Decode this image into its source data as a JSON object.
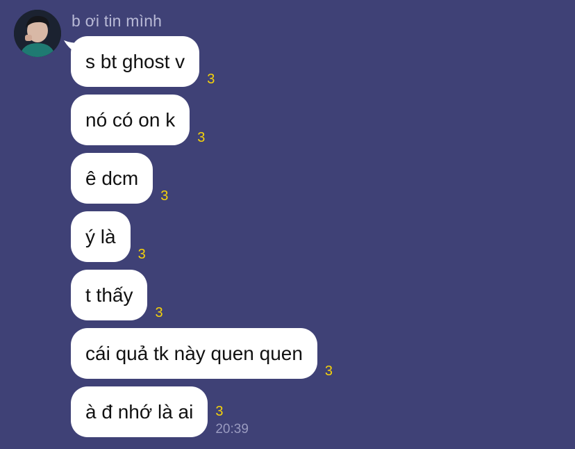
{
  "sender": {
    "name": "b ơi tin mình"
  },
  "messages": [
    {
      "text": "s bt ghost v",
      "read_count": "3"
    },
    {
      "text": "nó có on k",
      "read_count": "3"
    },
    {
      "text": "ê dcm",
      "read_count": "3"
    },
    {
      "text": "ý là",
      "read_count": "3"
    },
    {
      "text": "t thấy",
      "read_count": "3"
    },
    {
      "text": "cái quả tk này quen quen",
      "read_count": "3"
    },
    {
      "text": "à đ nhớ là ai",
      "read_count": "3",
      "time": "20:39"
    }
  ],
  "colors": {
    "background": "#3f4176",
    "bubble": "#ffffff",
    "read_count": "#f5d20a",
    "sender_name": "#b9bad6",
    "time": "#9a9bc0"
  }
}
